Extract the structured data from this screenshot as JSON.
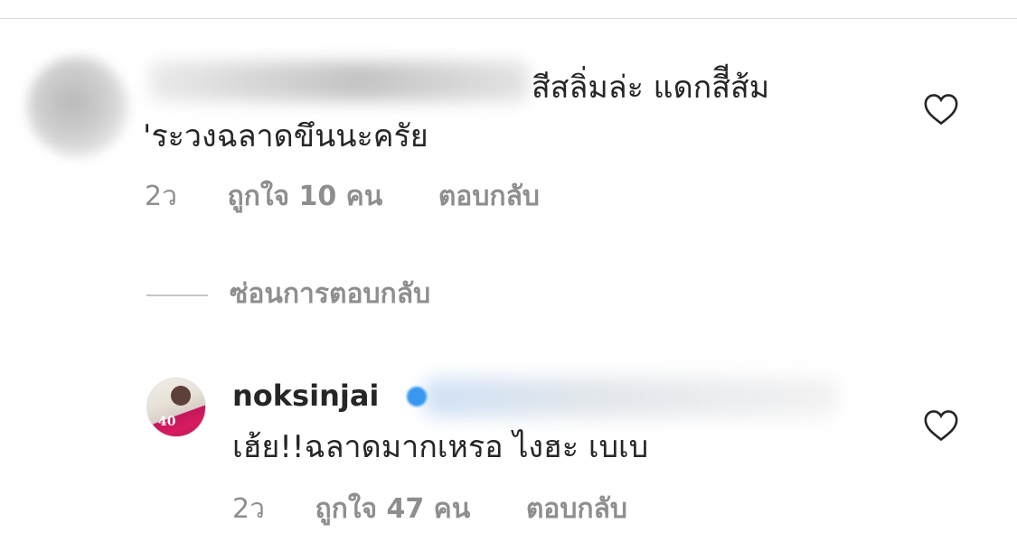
{
  "comments": [
    {
      "line1": "สีสลิ่มล่ะ แดกสีีส้ม",
      "line2": "'ระวงฉลาดขึนนะครัย",
      "time": "2ว",
      "likes": "ถูกใจ 10 คน",
      "reply_label": "ตอบกลับ"
    },
    {
      "username": "noksinjai",
      "text": "เฮ้ย!!ฉลาดมากเหรอ ไงฮะ เบเบ",
      "time": "2ว",
      "likes": "ถูกใจ 47 คน",
      "reply_label": "ตอบกลับ",
      "avatar_badge": "40"
    }
  ],
  "hide_replies_label": "ซ่อนการตอบกลับ",
  "colors": {
    "text": "#262626",
    "meta": "#8e8e8e",
    "verified": "#3897f0"
  },
  "icons": {
    "like": "heart-outline-icon",
    "verified": "verified-badge-icon"
  }
}
